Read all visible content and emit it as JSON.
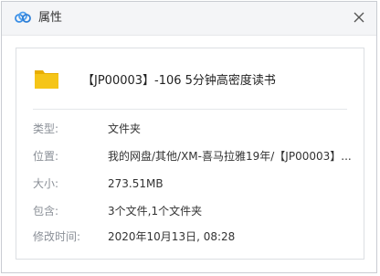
{
  "window": {
    "title": "属性",
    "app_icon": "cloud-icon",
    "close_icon": "close-icon"
  },
  "file": {
    "icon": "folder-icon",
    "name": "【JP00003】-106 5分钟高密度读书"
  },
  "properties": [
    {
      "label": "类型:",
      "value": "文件夹"
    },
    {
      "label": "位置:",
      "value": "我的网盘/其他/XM-喜马拉雅19年/【JP00003】..."
    },
    {
      "label": "大小:",
      "value": "273.51MB"
    },
    {
      "label": "包含:",
      "value": "3个文件,1个文件夹"
    },
    {
      "label": "修改时间:",
      "value": "2020年10月13日, 08:28"
    }
  ],
  "colors": {
    "folder": "#f5c518",
    "folder_tab": "#e8ae00",
    "app_icon": "#3a8ee6"
  }
}
